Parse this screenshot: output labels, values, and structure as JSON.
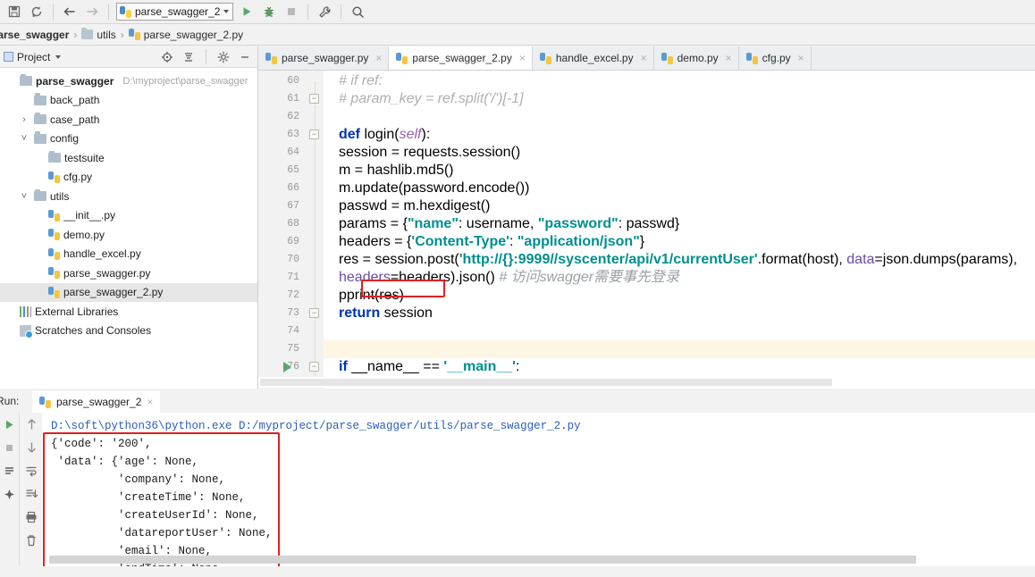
{
  "toolbar": {
    "icons": [
      {
        "name": "save-all-icon",
        "glyph": "ὋE"
      },
      {
        "name": "sync-icon",
        "glyph": "↻"
      },
      {
        "name": "back-icon",
        "glyph": "←"
      },
      {
        "name": "forward-icon",
        "glyph": "→"
      }
    ],
    "run_config": "parse_swagger_2",
    "run_label": "Run",
    "debug_label": "Debug",
    "stop_label": "Stop",
    "settings_label": "Settings",
    "search_label": "Search Everywhere"
  },
  "breadcrumb": {
    "project": "parse_swagger",
    "folder": "utils",
    "file": "parse_swagger_2.py",
    "separator": "›"
  },
  "project_panel": {
    "title": "Project",
    "caret": "▾",
    "locate_label": "Select Opened File",
    "collapse_label": "Collapse All",
    "settings_label": "Settings",
    "hide_label": "Hide",
    "items": [
      {
        "label": "parse_swagger",
        "path": "D:\\myproject\\parse_swagger",
        "type": "folder",
        "indent": 0,
        "arrow": "",
        "bold": true,
        "selected": false
      },
      {
        "label": "back_path",
        "path": "",
        "type": "folder",
        "indent": 1,
        "arrow": "",
        "bold": false,
        "selected": false
      },
      {
        "label": "case_path",
        "path": "",
        "type": "folder",
        "indent": 1,
        "arrow": "›",
        "bold": false,
        "selected": false
      },
      {
        "label": "config",
        "path": "",
        "type": "folder",
        "indent": 1,
        "arrow": "˅",
        "bold": false,
        "selected": false
      },
      {
        "label": "testsuite",
        "path": "",
        "type": "folder",
        "indent": 2,
        "arrow": "",
        "bold": false,
        "selected": false
      },
      {
        "label": "cfg.py",
        "path": "",
        "type": "python",
        "indent": 2,
        "arrow": "",
        "bold": false,
        "selected": false
      },
      {
        "label": "utils",
        "path": "",
        "type": "folder",
        "indent": 1,
        "arrow": "˅",
        "bold": false,
        "selected": false
      },
      {
        "label": "__init__.py",
        "path": "",
        "type": "python",
        "indent": 2,
        "arrow": "",
        "bold": false,
        "selected": false
      },
      {
        "label": "demo.py",
        "path": "",
        "type": "python",
        "indent": 2,
        "arrow": "",
        "bold": false,
        "selected": false
      },
      {
        "label": "handle_excel.py",
        "path": "",
        "type": "python",
        "indent": 2,
        "arrow": "",
        "bold": false,
        "selected": false
      },
      {
        "label": "parse_swagger.py",
        "path": "",
        "type": "python",
        "indent": 2,
        "arrow": "",
        "bold": false,
        "selected": false
      },
      {
        "label": "parse_swagger_2.py",
        "path": "",
        "type": "python",
        "indent": 2,
        "arrow": "",
        "bold": false,
        "selected": true
      },
      {
        "label": "External Libraries",
        "path": "",
        "type": "library",
        "indent": 0,
        "arrow": "",
        "bold": false,
        "selected": false
      },
      {
        "label": "Scratches and Consoles",
        "path": "",
        "type": "scratch",
        "indent": 0,
        "arrow": "",
        "bold": false,
        "selected": false
      }
    ]
  },
  "editor_tabs": [
    {
      "label": "parse_swagger.py",
      "active": false,
      "close": "×"
    },
    {
      "label": "parse_swagger_2.py",
      "active": true,
      "close": "×"
    },
    {
      "label": "handle_excel.py",
      "active": false,
      "close": "×"
    },
    {
      "label": "demo.py",
      "active": false,
      "close": "×"
    },
    {
      "label": "cfg.py",
      "active": false,
      "close": "×"
    }
  ],
  "editor": {
    "lines": [
      {
        "num": "60",
        "html": "<span class=\"cmt\">#                        if ref:</span>"
      },
      {
        "num": "61",
        "html": "<span class=\"cmt\">#                            param_key = ref.split('/')[-1]</span>"
      },
      {
        "num": "62",
        "html": ""
      },
      {
        "num": "63",
        "html": "    <span class=\"kw\">def</span> login(<span class=\"self\">self</span>):"
      },
      {
        "num": "64",
        "html": "        session = requests.session()"
      },
      {
        "num": "65",
        "html": "        m = hashlib.md5()"
      },
      {
        "num": "66",
        "html": "        m.update(password.encode())"
      },
      {
        "num": "67",
        "html": "        passwd = m.hexdigest()"
      },
      {
        "num": "68",
        "html": "        params = {<span class=\"str\">\"name\"</span>: username, <span class=\"str\">\"password\"</span>: passwd}"
      },
      {
        "num": "69",
        "html": "        headers = {<span class=\"str\">'Content-Type'</span>: <span class=\"str\">\"application/json\"</span>}"
      },
      {
        "num": "70",
        "html": "        res = session.post(<span class=\"str\">'http://{}:9999//syscenter/api/v1/currentUser'</span>.format(host), <span class=\"kwarg\">data</span>=json.dumps(params),"
      },
      {
        "num": "71",
        "html": "                      <span class=\"kwarg\">headers</span>=headers).json()  <span class=\"cmt2\"># 访问swagger需要事先登录</span>"
      },
      {
        "num": "72",
        "html": "        pprint(res)"
      },
      {
        "num": "73",
        "html": "        <span class=\"kw\">return</span> session"
      },
      {
        "num": "74",
        "html": ""
      },
      {
        "num": "75",
        "html": ""
      },
      {
        "num": "76",
        "html": "<span class=\"kw\">if</span> __name__ == <span class=\"str\">'__main__'</span>:"
      }
    ],
    "fold_lines": [
      "61",
      "63",
      "73",
      "76"
    ],
    "highlight_line": "75",
    "run_marker_line": "76",
    "fold_collapse_glyph": "−"
  },
  "run_panel": {
    "label": "Run:",
    "tab_label": "parse_swagger_2",
    "tab_close": "×",
    "side_icons": [
      {
        "name": "rerun-icon",
        "glyph": "▶"
      },
      {
        "name": "stop-icon",
        "glyph": "■"
      },
      {
        "name": "console-icon",
        "glyph": "≣"
      },
      {
        "name": "pin-icon",
        "glyph": "✦"
      }
    ],
    "tool_icons": [
      {
        "name": "scroll-up-icon",
        "glyph": "↑"
      },
      {
        "name": "scroll-down-icon",
        "glyph": "↓"
      },
      {
        "name": "soft-wrap-icon",
        "glyph": "↵"
      },
      {
        "name": "scroll-to-end-icon",
        "glyph": "↧"
      },
      {
        "name": "print-icon",
        "glyph": "⎙"
      },
      {
        "name": "clear-all-icon",
        "glyph": "🗑"
      }
    ],
    "command": "D:\\soft\\python36\\python.exe D:/myproject/parse_swagger/utils/parse_swagger_2.py",
    "output": [
      "{'code': '200',",
      " 'data': {'age': None,",
      "          'company': None,",
      "          'createTime': None,",
      "          'createUserId': None,",
      "          'datareportUser': None,",
      "          'email': None,",
      "          'endTime': None,"
    ]
  },
  "colors": {
    "accent_red": "#e02020",
    "keyword_blue": "#0033b3",
    "string_teal": "#008e8e",
    "comment_gray": "#b0b0b0",
    "run_green": "#59a869",
    "highlight_yellow": "#fdf6e3"
  }
}
